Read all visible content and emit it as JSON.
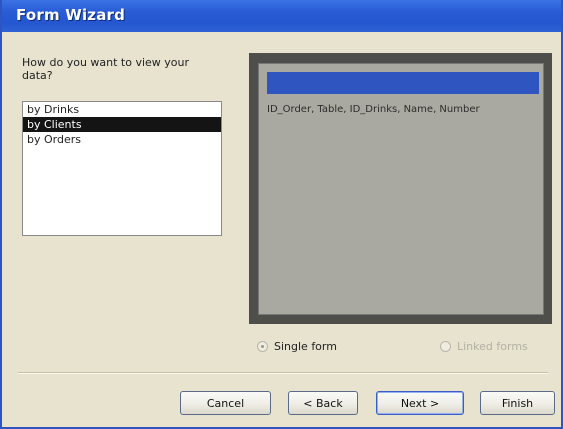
{
  "window": {
    "title": "Form Wizard"
  },
  "prompt": {
    "line1": "How do you want to view your",
    "line2": "data?"
  },
  "view_options": {
    "items": [
      {
        "label": "by Drinks",
        "selected": false
      },
      {
        "label": "by Clients",
        "selected": true
      },
      {
        "label": "by Orders",
        "selected": false
      }
    ]
  },
  "preview": {
    "fields": "ID_Order, Table, ID_Drinks, Name, Number"
  },
  "layout_options": {
    "single_form": "Single form",
    "linked_forms": "Linked forms",
    "selected": "single_form"
  },
  "buttons": {
    "cancel": "Cancel",
    "back": "< Back",
    "next": "Next >",
    "finish": "Finish"
  },
  "colors": {
    "titlebar": "#2457cf",
    "dialog_bg": "#e7e3cf",
    "preview_frame": "#4e4e4a",
    "preview_header": "#2f55c0",
    "selection": "#141414"
  }
}
